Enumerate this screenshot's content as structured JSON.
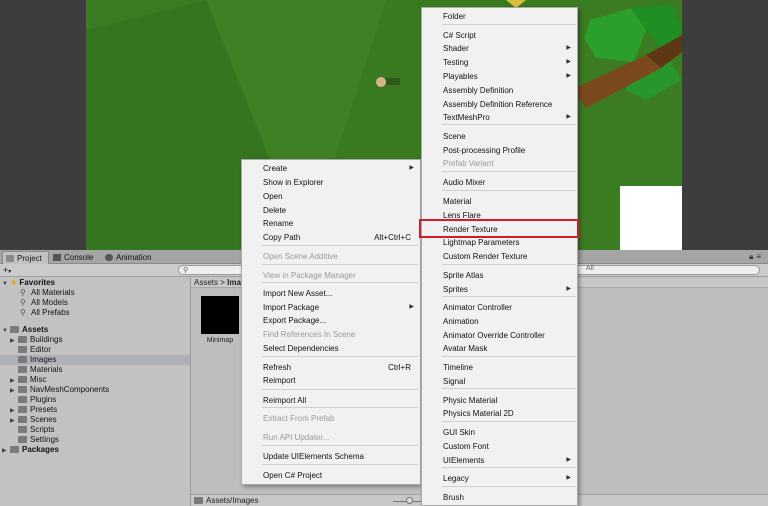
{
  "project_tabs": [
    {
      "label": "Project",
      "icon": "folder-icon"
    },
    {
      "label": "Console",
      "icon": "console-icon"
    },
    {
      "label": "Animation",
      "icon": "animation-icon"
    }
  ],
  "toolbar": {
    "add_label": "+",
    "add_caret": "▾",
    "search_scope": "All"
  },
  "tree": {
    "favorites_label": "Favorites",
    "favorites": [
      "All Materials",
      "All Models",
      "All Prefabs"
    ],
    "assets_label": "Assets",
    "assets": [
      "Buildings",
      "Editor",
      "Images",
      "Materials",
      "Misc",
      "NavMeshComponents",
      "Plugins",
      "Presets",
      "Scenes",
      "Scripts",
      "Settings"
    ],
    "packages_label": "Packages"
  },
  "assets_view": {
    "breadcrumb_root": "Assets",
    "breadcrumb_sep": ">",
    "breadcrumb_current": "Ima",
    "thumb_label": "Minimap",
    "footer_path": "Assets/Images"
  },
  "context_menu": [
    {
      "label": "Create",
      "submenu": true
    },
    {
      "label": "Show in Explorer"
    },
    {
      "label": "Open"
    },
    {
      "label": "Delete"
    },
    {
      "label": "Rename"
    },
    {
      "label": "Copy Path",
      "shortcut": "Alt+Ctrl+C"
    },
    {
      "label": "Open Scene Additive",
      "disabled": true
    },
    {
      "label": "View in Package Manager",
      "disabled": true
    },
    {
      "label": "Import New Asset..."
    },
    {
      "label": "Import Package",
      "submenu": true
    },
    {
      "label": "Export Package..."
    },
    {
      "label": "Find References In Scene",
      "disabled": true
    },
    {
      "label": "Select Dependencies"
    },
    {
      "label": "Refresh",
      "shortcut": "Ctrl+R"
    },
    {
      "label": "Reimport"
    },
    {
      "label": "Reimport All"
    },
    {
      "label": "Extract From Prefab",
      "disabled": true
    },
    {
      "label": "Run API Updater...",
      "disabled": true
    },
    {
      "label": "Update UIElements Schema"
    },
    {
      "label": "Open C# Project"
    }
  ],
  "create_submenu": [
    {
      "label": "Folder"
    },
    {
      "label": "C# Script"
    },
    {
      "label": "Shader",
      "submenu": true
    },
    {
      "label": "Testing",
      "submenu": true
    },
    {
      "label": "Playables",
      "submenu": true
    },
    {
      "label": "Assembly Definition"
    },
    {
      "label": "Assembly Definition Reference"
    },
    {
      "label": "TextMeshPro",
      "submenu": true
    },
    {
      "label": "Scene"
    },
    {
      "label": "Post-processing Profile"
    },
    {
      "label": "Prefab Variant",
      "disabled": true
    },
    {
      "label": "Audio Mixer"
    },
    {
      "label": "Material"
    },
    {
      "label": "Lens Flare"
    },
    {
      "label": "Render Texture",
      "highlighted": true
    },
    {
      "label": "Lightmap Parameters"
    },
    {
      "label": "Custom Render Texture"
    },
    {
      "label": "Sprite Atlas"
    },
    {
      "label": "Sprites",
      "submenu": true
    },
    {
      "label": "Animator Controller"
    },
    {
      "label": "Animation"
    },
    {
      "label": "Animator Override Controller"
    },
    {
      "label": "Avatar Mask"
    },
    {
      "label": "Timeline"
    },
    {
      "label": "Signal"
    },
    {
      "label": "Physic Material"
    },
    {
      "label": "Physics Material 2D"
    },
    {
      "label": "GUI Skin"
    },
    {
      "label": "Custom Font"
    },
    {
      "label": "UIElements",
      "submenu": true
    },
    {
      "label": "Legacy",
      "submenu": true
    },
    {
      "label": "Brush"
    }
  ],
  "colors": {
    "highlight_border": "#d21d24",
    "scene_ground": "#3a7a23",
    "selected_row": "#aeb2b8"
  }
}
